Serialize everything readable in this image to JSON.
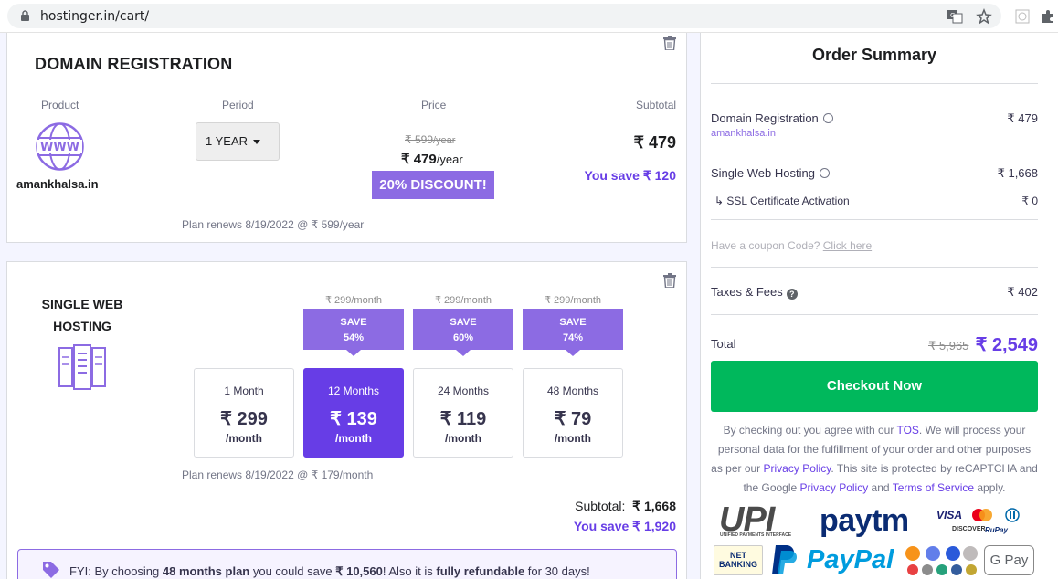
{
  "browser": {
    "url": "hostinger.in/cart/"
  },
  "domain": {
    "title": "DOMAIN REGISTRATION",
    "col_product": "Product",
    "col_period": "Period",
    "col_price": "Price",
    "col_subtotal": "Subtotal",
    "domain_name": "amankhalsa.in",
    "www_label": "WWW",
    "period": "1 YEAR",
    "old_price": "₹ 599",
    "old_price_unit": "/year",
    "price": "₹ 479",
    "price_unit": "/year",
    "discount": "20% DISCOUNT!",
    "subtotal": "₹ 479",
    "you_save": "You save ₹ 120",
    "renews": "Plan renews 8/19/2022 @ ₹ 599/year"
  },
  "hosting": {
    "title_line1": "SINGLE WEB",
    "title_line2": "HOSTING",
    "plans": [
      {
        "months": "1 Month",
        "price": "₹ 299",
        "unit": "/month",
        "old": "",
        "save_line1": "",
        "save_line2": "",
        "selected": false
      },
      {
        "months": "12 Months",
        "price": "₹ 139",
        "unit": "/month",
        "old": "₹ 299/month",
        "save_line1": "SAVE",
        "save_line2": "54%",
        "selected": true
      },
      {
        "months": "24 Months",
        "price": "₹ 119",
        "unit": "/month",
        "old": "₹ 299/month",
        "save_line1": "SAVE",
        "save_line2": "60%",
        "selected": false
      },
      {
        "months": "48 Months",
        "price": "₹ 79",
        "unit": "/month",
        "old": "₹ 299/month",
        "save_line1": "SAVE",
        "save_line2": "74%",
        "selected": false
      }
    ],
    "renews": "Plan renews 8/19/2022 @ ₹ 179/month",
    "subtotal_label": "Subtotal:",
    "subtotal": "₹ 1,668",
    "you_save": "You save ₹ 1,920",
    "fyi_prefix": "FYI: By choosing ",
    "fyi_plan": "48 months plan",
    "fyi_mid": " you could save ",
    "fyi_amount": "₹ 10,560",
    "fyi_mid2": "! Also it is ",
    "fyi_refund": "fully refundable",
    "fyi_suffix": " for 30 days!"
  },
  "summary": {
    "title": "Order Summary",
    "domain_label": "Domain Registration",
    "domain_value": "₹ 479",
    "domain_sub": "amankhalsa.in",
    "hosting_label": "Single Web Hosting",
    "hosting_value": "₹ 1,668",
    "ssl_label": "↳ SSL Certificate Activation",
    "ssl_value": "₹ 0",
    "coupon_text": "Have a coupon Code?",
    "coupon_link": "Click here",
    "taxes_label": "Taxes & Fees",
    "taxes_value": "₹ 402",
    "total_label": "Total",
    "total_old": "₹ 5,965",
    "total": "₹ 2,549",
    "checkout": "Checkout Now",
    "legal": {
      "p1": "By checking out you agree with our ",
      "tos": "TOS",
      "p2": ". We will process your personal data for the fulfillment of your order and other purposes as per our ",
      "privacy1": "Privacy Policy",
      "p3": ". This site is protected by reCAPTCHA and the Google ",
      "privacy2": "Privacy Policy",
      "p4": " and ",
      "terms": "Terms of Service",
      "p5": " apply."
    },
    "payments": {
      "upi": "UPI",
      "upi_sub": "UNIFIED PAYMENTS INTERFACE",
      "paytm": "paytm",
      "visa": "VISA",
      "discover": "DISCOVER",
      "rupay": "RuPay",
      "netbanking_1": "NET",
      "netbanking_2": "BANKING",
      "paypal": "PayPal",
      "gpay": "G Pay"
    }
  },
  "colors": {
    "brand_purple": "#673de6",
    "light_purple": "#8c6be3",
    "checkout_green": "#00b85c"
  }
}
